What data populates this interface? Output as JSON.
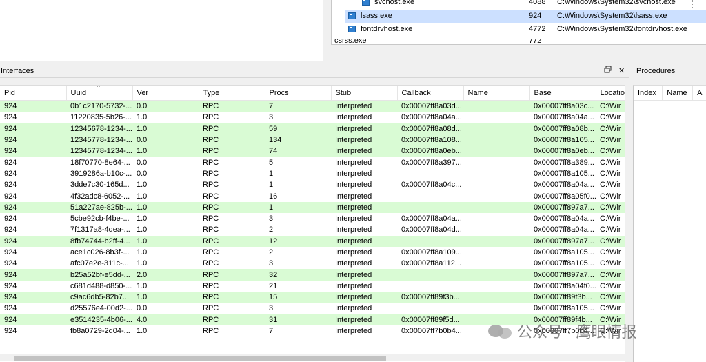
{
  "processes": [
    {
      "name": "svchost.exe",
      "pid": "4088",
      "path": "C:\\Windows\\System32\\svchost.exe",
      "selected": false
    },
    {
      "name": "lsass.exe",
      "pid": "924",
      "path": "C:\\Windows\\System32\\lsass.exe",
      "selected": true
    },
    {
      "name": "fontdrvhost.exe",
      "pid": "4772",
      "path": "C:\\Windows\\System32\\fontdrvhost.exe",
      "selected": false
    },
    {
      "name": "csrss.exe",
      "pid": "772",
      "path": "",
      "selected": false
    }
  ],
  "interfaces_panel": {
    "title": "Interfaces",
    "float_icon": "restore-window-icon",
    "close_glyph": "✕",
    "columns": [
      "Pid",
      "Uuid",
      "Ver",
      "Type",
      "Procs",
      "Stub",
      "Callback",
      "Name",
      "Base",
      "Location"
    ],
    "sorted_column": "Uuid",
    "rows": [
      {
        "pid": "924",
        "uuid": "0b1c2170-5732-...",
        "ver": "0.0",
        "type": "RPC",
        "procs": "7",
        "stub": "Interpreted",
        "callback": "0x00007ff8a03d...",
        "name": "",
        "base": "0x00007ff8a03c...",
        "location": "C:\\Wir",
        "hl": true
      },
      {
        "pid": "924",
        "uuid": "11220835-5b26-...",
        "ver": "1.0",
        "type": "RPC",
        "procs": "3",
        "stub": "Interpreted",
        "callback": "0x00007ff8a04a...",
        "name": "",
        "base": "0x00007ff8a04a...",
        "location": "C:\\Wir",
        "hl": false
      },
      {
        "pid": "924",
        "uuid": "12345678-1234-...",
        "ver": "1.0",
        "type": "RPC",
        "procs": "59",
        "stub": "Interpreted",
        "callback": "0x00007ff8a08d...",
        "name": "",
        "base": "0x00007ff8a08b...",
        "location": "C:\\Wir",
        "hl": true
      },
      {
        "pid": "924",
        "uuid": "12345778-1234-...",
        "ver": "0.0",
        "type": "RPC",
        "procs": "134",
        "stub": "Interpreted",
        "callback": "0x00007ff8a108...",
        "name": "",
        "base": "0x00007ff8a105...",
        "location": "C:\\Wir",
        "hl": true
      },
      {
        "pid": "924",
        "uuid": "12345778-1234-...",
        "ver": "1.0",
        "type": "RPC",
        "procs": "74",
        "stub": "Interpreted",
        "callback": "0x00007ff8a0eb...",
        "name": "",
        "base": "0x00007ff8a0eb...",
        "location": "C:\\Wir",
        "hl": true
      },
      {
        "pid": "924",
        "uuid": "18f70770-8e64-...",
        "ver": "0.0",
        "type": "RPC",
        "procs": "5",
        "stub": "Interpreted",
        "callback": "0x00007ff8a397...",
        "name": "",
        "base": "0x00007ff8a389...",
        "location": "C:\\Wir",
        "hl": false
      },
      {
        "pid": "924",
        "uuid": "3919286a-b10c-...",
        "ver": "0.0",
        "type": "RPC",
        "procs": "1",
        "stub": "Interpreted",
        "callback": "",
        "name": "",
        "base": "0x00007ff8a105...",
        "location": "C:\\Wir",
        "hl": false
      },
      {
        "pid": "924",
        "uuid": "3dde7c30-165d...",
        "ver": "1.0",
        "type": "RPC",
        "procs": "1",
        "stub": "Interpreted",
        "callback": "0x00007ff8a04c...",
        "name": "",
        "base": "0x00007ff8a04a...",
        "location": "C:\\Wir",
        "hl": false
      },
      {
        "pid": "924",
        "uuid": "4f32adc8-6052-...",
        "ver": "1.0",
        "type": "RPC",
        "procs": "16",
        "stub": "Interpreted",
        "callback": "",
        "name": "",
        "base": "0x00007ff8a05f0...",
        "location": "C:\\Wir",
        "hl": false
      },
      {
        "pid": "924",
        "uuid": "51a227ae-825b-...",
        "ver": "1.0",
        "type": "RPC",
        "procs": "1",
        "stub": "Interpreted",
        "callback": "",
        "name": "",
        "base": "0x00007ff897a7...",
        "location": "C:\\Wir",
        "hl": true
      },
      {
        "pid": "924",
        "uuid": "5cbe92cb-f4be-...",
        "ver": "1.0",
        "type": "RPC",
        "procs": "3",
        "stub": "Interpreted",
        "callback": "0x00007ff8a04a...",
        "name": "",
        "base": "0x00007ff8a04a...",
        "location": "C:\\Wir",
        "hl": false
      },
      {
        "pid": "924",
        "uuid": "7f1317a8-4dea-...",
        "ver": "1.0",
        "type": "RPC",
        "procs": "2",
        "stub": "Interpreted",
        "callback": "0x00007ff8a04d...",
        "name": "",
        "base": "0x00007ff8a04a...",
        "location": "C:\\Wir",
        "hl": false
      },
      {
        "pid": "924",
        "uuid": "8fb74744-b2ff-4...",
        "ver": "1.0",
        "type": "RPC",
        "procs": "12",
        "stub": "Interpreted",
        "callback": "",
        "name": "",
        "base": "0x00007ff897a7...",
        "location": "C:\\Wir",
        "hl": true
      },
      {
        "pid": "924",
        "uuid": "ace1c026-8b3f-...",
        "ver": "1.0",
        "type": "RPC",
        "procs": "2",
        "stub": "Interpreted",
        "callback": "0x00007ff8a109...",
        "name": "",
        "base": "0x00007ff8a105...",
        "location": "C:\\Wir",
        "hl": false
      },
      {
        "pid": "924",
        "uuid": "afc07e2e-311c-...",
        "ver": "1.0",
        "type": "RPC",
        "procs": "3",
        "stub": "Interpreted",
        "callback": "0x00007ff8a112...",
        "name": "",
        "base": "0x00007ff8a105...",
        "location": "C:\\Wir",
        "hl": false
      },
      {
        "pid": "924",
        "uuid": "b25a52bf-e5dd-...",
        "ver": "2.0",
        "type": "RPC",
        "procs": "32",
        "stub": "Interpreted",
        "callback": "",
        "name": "",
        "base": "0x00007ff897a7...",
        "location": "C:\\Wir",
        "hl": true
      },
      {
        "pid": "924",
        "uuid": "c681d488-d850-...",
        "ver": "1.0",
        "type": "RPC",
        "procs": "21",
        "stub": "Interpreted",
        "callback": "",
        "name": "",
        "base": "0x00007ff8a04f0...",
        "location": "C:\\Wir",
        "hl": false
      },
      {
        "pid": "924",
        "uuid": "c9ac6db5-82b7...",
        "ver": "1.0",
        "type": "RPC",
        "procs": "15",
        "stub": "Interpreted",
        "callback": "0x00007ff89f3b...",
        "name": "",
        "base": "0x00007ff89f3b...",
        "location": "C:\\Wir",
        "hl": true
      },
      {
        "pid": "924",
        "uuid": "d25576e4-00d2-...",
        "ver": "0.0",
        "type": "RPC",
        "procs": "3",
        "stub": "Interpreted",
        "callback": "",
        "name": "",
        "base": "0x00007ff8a105...",
        "location": "C:\\Wir",
        "hl": false
      },
      {
        "pid": "924",
        "uuid": "e3514235-4b06-...",
        "ver": "4.0",
        "type": "RPC",
        "procs": "31",
        "stub": "Interpreted",
        "callback": "0x00007ff89f5d...",
        "name": "",
        "base": "0x00007ff89f4b...",
        "location": "C:\\Wir",
        "hl": true
      },
      {
        "pid": "924",
        "uuid": "fb8a0729-2d04-...",
        "ver": "1.0",
        "type": "RPC",
        "procs": "7",
        "stub": "Interpreted",
        "callback": "0x00007ff7b0b4...",
        "name": "",
        "base": "0x00007ff7b0b4...",
        "location": "C:\\Wir",
        "hl": false
      }
    ]
  },
  "procedures_panel": {
    "title": "Procedures",
    "columns": [
      "Index",
      "Name",
      "A"
    ]
  },
  "watermark": {
    "text": "公众号 · 鹰眼情报",
    "icon": "wechat-logo-icon"
  },
  "colors": {
    "row_highlight": "#d9fbd4",
    "selected_process": "#cce0ff",
    "process_icon": "#2f7fd0"
  }
}
